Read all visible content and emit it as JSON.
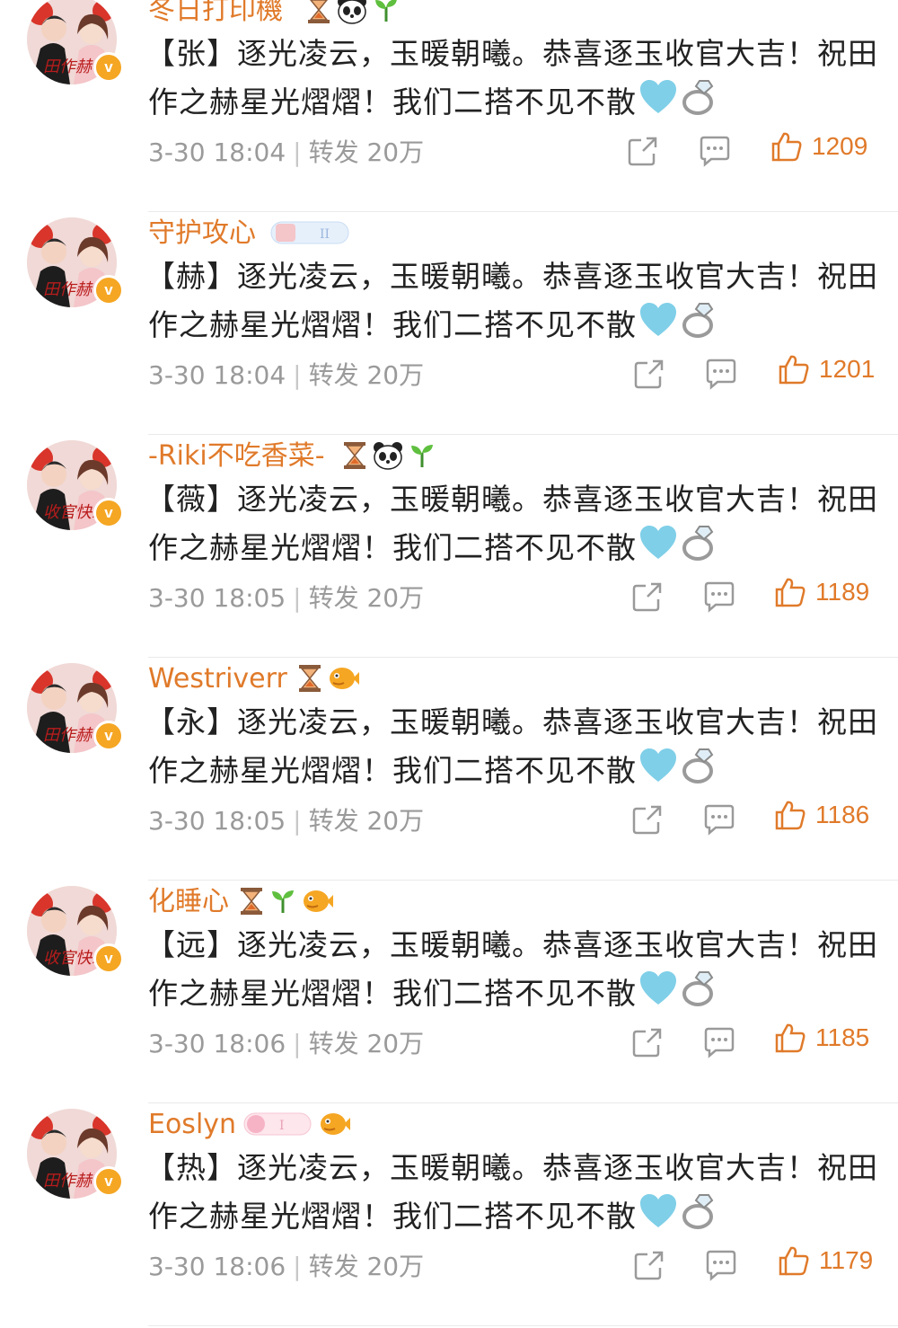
{
  "comments": [
    {
      "username": "冬日打印機",
      "prefix": "【张】",
      "text1": "逐光凌云，玉暖朝曦。恭喜逐玉收官大吉！祝田",
      "text2": "作之赫星光熠熠！我们二搭不见不散",
      "time": "3-30 18:04",
      "repost": "转发 20万",
      "likes": "1209",
      "badges": [
        "hourglass-icon",
        "panda-icon",
        "sprout-icon"
      ],
      "avatar_caption": "田作赫"
    },
    {
      "username": "守护攻心",
      "prefix": "【赫】",
      "text1": "逐光凌云，玉暖朝曦。恭喜逐玉收官大吉！祝田",
      "text2": "作之赫星光熠熠！我们二搭不见不散",
      "time": "3-30 18:04",
      "repost": "转发 20万",
      "likes": "1201",
      "badges": [
        "fan-level-badge"
      ],
      "avatar_caption": "田作赫"
    },
    {
      "username": "-Riki不吃香菜-",
      "prefix": "【薇】",
      "text1": "逐光凌云，玉暖朝曦。恭喜逐玉收官大吉！祝田",
      "text2": "作之赫星光熠熠！我们二搭不见不散",
      "time": "3-30 18:05",
      "repost": "转发 20万",
      "likes": "1189",
      "badges": [
        "hourglass-icon",
        "panda-icon",
        "sprout-icon"
      ],
      "avatar_caption": "收官快乐"
    },
    {
      "username": "Westriverr",
      "prefix": "【永】",
      "text1": "逐光凌云，玉暖朝曦。恭喜逐玉收官大吉！祝田",
      "text2": "作之赫星光熠熠！我们二搭不见不散",
      "time": "3-30 18:05",
      "repost": "转发 20万",
      "likes": "1186",
      "badges": [
        "hourglass-icon",
        "pufferfish-icon"
      ],
      "avatar_caption": "田作赫"
    },
    {
      "username": "化睡心",
      "prefix": "【远】",
      "text1": "逐光凌云，玉暖朝曦。恭喜逐玉收官大吉！祝田",
      "text2": "作之赫星光熠熠！我们二搭不见不散",
      "time": "3-30 18:06",
      "repost": "转发 20万",
      "likes": "1185",
      "badges": [
        "hourglass-icon",
        "sprout-icon",
        "pufferfish-icon"
      ],
      "avatar_caption": "收官快乐"
    },
    {
      "username": "Eoslyn",
      "prefix": "【热】",
      "text1": "逐光凌云，玉暖朝曦。恭喜逐玉收官大吉！祝田",
      "text2": "作之赫星光熠熠！我们二搭不见不散",
      "time": "3-30 18:06",
      "repost": "转发 20万",
      "likes": "1179",
      "badges": [
        "fan-level-badge-pink",
        "pufferfish-icon"
      ],
      "avatar_caption": "田作赫"
    }
  ],
  "colors": {
    "accent": "#e07a2a",
    "meta": "#9a9a9a",
    "text": "#222222",
    "verified": "#f5a623"
  }
}
